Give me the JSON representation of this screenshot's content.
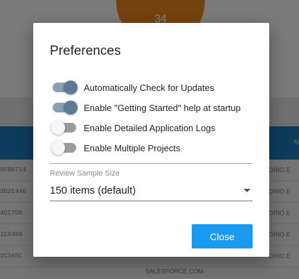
{
  "background": {
    "avatar_text": "34",
    "table_header_label": "N",
    "rows": [
      {
        "col1": "5FB6714",
        "col2": "ORIO E"
      },
      {
        "col1": "3D2E440",
        "col2": "ORIO E"
      },
      {
        "col1": "4CC7D0",
        "col2": "ORIO E"
      },
      {
        "col1": "1C9460",
        "col2": "ORIO E"
      },
      {
        "col1": "1C3A5C",
        "col2": "ORIO E"
      }
    ],
    "footer_text": "SALESFORCE.COM"
  },
  "dialog": {
    "title": "Preferences",
    "toggles": [
      {
        "label": "Automatically Check for Updates",
        "checked": true
      },
      {
        "label": "Enable \"Getting Started\" help at startup",
        "checked": true
      },
      {
        "label": "Enable Detailed Application Logs",
        "checked": false
      },
      {
        "label": "Enable Multiple Projects",
        "checked": false
      }
    ],
    "review_sample": {
      "caption": "Review Sample Size",
      "value": "150 items (default)"
    },
    "close_label": "Close"
  },
  "colors": {
    "toggle_on_thumb": "#5d7a94",
    "toggle_on_track": "#8ba0b4",
    "toggle_off_thumb": "#f7f7f7",
    "toggle_off_track": "#9b9b9b",
    "primary_button": "#1a9bf0",
    "table_header": "#1e78b8",
    "avatar": "#e8841f"
  }
}
